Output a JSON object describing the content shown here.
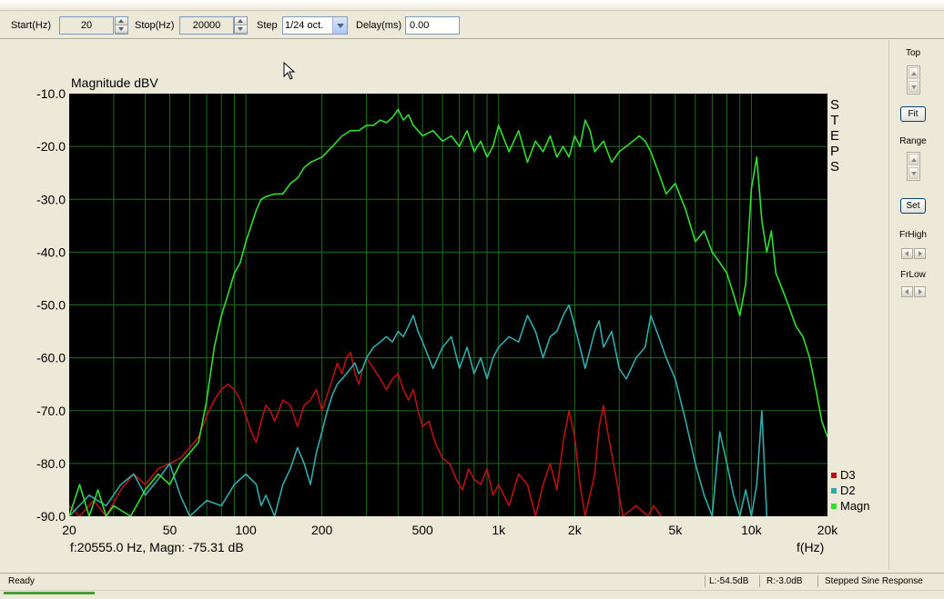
{
  "toolbar": {
    "start_label": "Start(Hz)",
    "start_value": "20",
    "stop_label": "Stop(Hz)",
    "stop_value": "20000",
    "step_label": "Step",
    "step_value": "1/24 oct.",
    "delay_label": "Delay(ms)",
    "delay_value": "0.00"
  },
  "side_panel": {
    "top_label": "Top",
    "fit_label": "Fit",
    "range_label": "Range",
    "set_label": "Set",
    "frhigh_label": "FrHigh",
    "frlow_label": "FrLow"
  },
  "plot": {
    "steps_text": "STEPS",
    "cursor_readout": "f:20555.0 Hz, Magn: -75.31 dB"
  },
  "status": {
    "left": "Ready",
    "level_l": "L:-54.5dB",
    "level_r": "R:-3.0dB",
    "mode": "Stepped Sine Response"
  },
  "colors": {
    "plot_background": "#000000",
    "grid": "#1f6b1f",
    "magn": "#33dd33",
    "d2": "#33aaaa",
    "d3": "#bb1111"
  },
  "chart_data": {
    "type": "line",
    "title": "",
    "ylabel": "Magnitude dBV",
    "xlabel": "f(Hz)",
    "xscale": "log",
    "xlim": [
      20,
      20000
    ],
    "ylim": [
      -90,
      -10
    ],
    "grid": true,
    "legend": "bottom-right",
    "x_ticks": [
      "20",
      "50",
      "100",
      "200",
      "500",
      "1k",
      "2k",
      "5k",
      "10k",
      "20k"
    ],
    "y_ticks": [
      "-10.0",
      "-20.0",
      "-30.0",
      "-40.0",
      "-50.0",
      "-60.0",
      "-70.0",
      "-80.0",
      "-90.0"
    ],
    "series": [
      {
        "name": "D3",
        "color": "#bb1111",
        "points": [
          [
            20,
            -88
          ],
          [
            22,
            -90
          ],
          [
            25,
            -87
          ],
          [
            28,
            -90
          ],
          [
            32,
            -85
          ],
          [
            36,
            -82
          ],
          [
            40,
            -84
          ],
          [
            45,
            -81
          ],
          [
            50,
            -80
          ],
          [
            55,
            -79
          ],
          [
            60,
            -77
          ],
          [
            65,
            -75
          ],
          [
            70,
            -71
          ],
          [
            75,
            -68
          ],
          [
            80,
            -66
          ],
          [
            85,
            -65
          ],
          [
            90,
            -66
          ],
          [
            95,
            -68
          ],
          [
            100,
            -71
          ],
          [
            105,
            -74
          ],
          [
            110,
            -76
          ],
          [
            115,
            -72
          ],
          [
            120,
            -69
          ],
          [
            125,
            -70
          ],
          [
            130,
            -72
          ],
          [
            135,
            -70
          ],
          [
            140,
            -68
          ],
          [
            150,
            -69
          ],
          [
            160,
            -73
          ],
          [
            170,
            -69
          ],
          [
            180,
            -68
          ],
          [
            190,
            -66
          ],
          [
            200,
            -70
          ],
          [
            210,
            -67
          ],
          [
            220,
            -64
          ],
          [
            230,
            -61
          ],
          [
            240,
            -63
          ],
          [
            250,
            -60
          ],
          [
            260,
            -59
          ],
          [
            270,
            -63
          ],
          [
            280,
            -65
          ],
          [
            290,
            -62
          ],
          [
            300,
            -60
          ],
          [
            320,
            -62
          ],
          [
            340,
            -64
          ],
          [
            360,
            -66
          ],
          [
            380,
            -64
          ],
          [
            400,
            -63
          ],
          [
            420,
            -66
          ],
          [
            440,
            -68
          ],
          [
            460,
            -66
          ],
          [
            480,
            -70
          ],
          [
            500,
            -73
          ],
          [
            530,
            -72
          ],
          [
            560,
            -76
          ],
          [
            600,
            -79
          ],
          [
            640,
            -80
          ],
          [
            680,
            -83
          ],
          [
            720,
            -85
          ],
          [
            760,
            -81
          ],
          [
            800,
            -83
          ],
          [
            850,
            -84
          ],
          [
            900,
            -81
          ],
          [
            950,
            -86
          ],
          [
            1000,
            -84
          ],
          [
            1100,
            -88
          ],
          [
            1200,
            -82
          ],
          [
            1300,
            -84
          ],
          [
            1400,
            -90
          ],
          [
            1500,
            -84
          ],
          [
            1600,
            -80
          ],
          [
            1700,
            -85
          ],
          [
            1800,
            -76
          ],
          [
            1900,
            -70
          ],
          [
            2000,
            -75
          ],
          [
            2100,
            -84
          ],
          [
            2200,
            -90
          ],
          [
            2400,
            -82
          ],
          [
            2500,
            -73
          ],
          [
            2600,
            -69
          ],
          [
            2700,
            -74
          ],
          [
            2900,
            -82
          ],
          [
            3100,
            -90
          ],
          [
            3500,
            -88
          ],
          [
            3900,
            -90
          ],
          [
            4100,
            -88
          ],
          [
            4400,
            -90
          ]
        ]
      },
      {
        "name": "D2",
        "color": "#33aaaa",
        "points": [
          [
            20,
            -90
          ],
          [
            24,
            -86
          ],
          [
            28,
            -88
          ],
          [
            32,
            -84
          ],
          [
            36,
            -82
          ],
          [
            40,
            -86
          ],
          [
            45,
            -83
          ],
          [
            50,
            -80
          ],
          [
            55,
            -86
          ],
          [
            60,
            -90
          ],
          [
            70,
            -87
          ],
          [
            80,
            -88
          ],
          [
            90,
            -84
          ],
          [
            100,
            -82
          ],
          [
            110,
            -84
          ],
          [
            115,
            -88
          ],
          [
            120,
            -86
          ],
          [
            130,
            -90
          ],
          [
            140,
            -84
          ],
          [
            150,
            -81
          ],
          [
            160,
            -77
          ],
          [
            170,
            -80
          ],
          [
            180,
            -84
          ],
          [
            190,
            -78
          ],
          [
            200,
            -74
          ],
          [
            210,
            -70
          ],
          [
            220,
            -67
          ],
          [
            230,
            -65
          ],
          [
            240,
            -64
          ],
          [
            250,
            -63
          ],
          [
            260,
            -62
          ],
          [
            270,
            -61
          ],
          [
            280,
            -63
          ],
          [
            290,
            -62
          ],
          [
            300,
            -60
          ],
          [
            320,
            -58
          ],
          [
            340,
            -57
          ],
          [
            360,
            -56
          ],
          [
            380,
            -57
          ],
          [
            400,
            -55
          ],
          [
            420,
            -56
          ],
          [
            440,
            -54
          ],
          [
            460,
            -52
          ],
          [
            480,
            -55
          ],
          [
            500,
            -57
          ],
          [
            550,
            -62
          ],
          [
            600,
            -58
          ],
          [
            650,
            -56
          ],
          [
            700,
            -62
          ],
          [
            750,
            -58
          ],
          [
            800,
            -63
          ],
          [
            850,
            -60
          ],
          [
            900,
            -64
          ],
          [
            950,
            -60
          ],
          [
            1000,
            -58
          ],
          [
            1100,
            -56
          ],
          [
            1200,
            -57
          ],
          [
            1300,
            -52
          ],
          [
            1400,
            -55
          ],
          [
            1500,
            -60
          ],
          [
            1600,
            -56
          ],
          [
            1700,
            -55
          ],
          [
            1800,
            -52
          ],
          [
            1900,
            -50
          ],
          [
            2000,
            -54
          ],
          [
            2100,
            -58
          ],
          [
            2200,
            -62
          ],
          [
            2400,
            -55
          ],
          [
            2500,
            -53
          ],
          [
            2600,
            -58
          ],
          [
            2800,
            -55
          ],
          [
            3000,
            -62
          ],
          [
            3200,
            -64
          ],
          [
            3500,
            -60
          ],
          [
            3800,
            -58
          ],
          [
            4000,
            -52
          ],
          [
            4300,
            -56
          ],
          [
            4600,
            -60
          ],
          [
            5000,
            -64
          ],
          [
            5500,
            -72
          ],
          [
            6000,
            -80
          ],
          [
            6500,
            -86
          ],
          [
            7000,
            -90
          ],
          [
            7500,
            -74
          ],
          [
            8000,
            -80
          ],
          [
            8500,
            -86
          ],
          [
            9000,
            -90
          ],
          [
            9500,
            -85
          ],
          [
            10000,
            -90
          ],
          [
            10500,
            -84
          ],
          [
            11000,
            -70
          ],
          [
            11500,
            -90
          ]
        ]
      },
      {
        "name": "Magn",
        "color": "#33dd33",
        "points": [
          [
            20,
            -90
          ],
          [
            22,
            -84
          ],
          [
            24,
            -90
          ],
          [
            26,
            -85
          ],
          [
            28,
            -90
          ],
          [
            30,
            -88
          ],
          [
            35,
            -90
          ],
          [
            40,
            -85
          ],
          [
            45,
            -82
          ],
          [
            50,
            -84
          ],
          [
            55,
            -80
          ],
          [
            60,
            -78
          ],
          [
            65,
            -76
          ],
          [
            70,
            -68
          ],
          [
            75,
            -58
          ],
          [
            80,
            -52
          ],
          [
            85,
            -48
          ],
          [
            90,
            -44
          ],
          [
            95,
            -42
          ],
          [
            100,
            -38
          ],
          [
            105,
            -35
          ],
          [
            110,
            -32
          ],
          [
            115,
            -30
          ],
          [
            120,
            -29.5
          ],
          [
            130,
            -29
          ],
          [
            140,
            -29
          ],
          [
            150,
            -27
          ],
          [
            160,
            -26
          ],
          [
            170,
            -24
          ],
          [
            180,
            -23
          ],
          [
            200,
            -22
          ],
          [
            220,
            -20
          ],
          [
            240,
            -18
          ],
          [
            260,
            -17
          ],
          [
            280,
            -17
          ],
          [
            300,
            -16
          ],
          [
            320,
            -16
          ],
          [
            340,
            -15
          ],
          [
            360,
            -15.5
          ],
          [
            380,
            -14.5
          ],
          [
            400,
            -13
          ],
          [
            420,
            -15
          ],
          [
            440,
            -14
          ],
          [
            460,
            -16
          ],
          [
            480,
            -17
          ],
          [
            500,
            -18
          ],
          [
            550,
            -17
          ],
          [
            600,
            -19
          ],
          [
            650,
            -18
          ],
          [
            700,
            -20
          ],
          [
            750,
            -17
          ],
          [
            800,
            -21
          ],
          [
            850,
            -19
          ],
          [
            900,
            -22
          ],
          [
            950,
            -20
          ],
          [
            1000,
            -16
          ],
          [
            1100,
            -21
          ],
          [
            1200,
            -17
          ],
          [
            1300,
            -23
          ],
          [
            1400,
            -19
          ],
          [
            1500,
            -21
          ],
          [
            1600,
            -18
          ],
          [
            1700,
            -22
          ],
          [
            1800,
            -20
          ],
          [
            1900,
            -22
          ],
          [
            2000,
            -18
          ],
          [
            2100,
            -20
          ],
          [
            2200,
            -15
          ],
          [
            2300,
            -17
          ],
          [
            2400,
            -21
          ],
          [
            2600,
            -19
          ],
          [
            2800,
            -23
          ],
          [
            3000,
            -21
          ],
          [
            3200,
            -20
          ],
          [
            3400,
            -19
          ],
          [
            3600,
            -18
          ],
          [
            3800,
            -19
          ],
          [
            4000,
            -21
          ],
          [
            4300,
            -25
          ],
          [
            4600,
            -29
          ],
          [
            5000,
            -27
          ],
          [
            5500,
            -32
          ],
          [
            6000,
            -38
          ],
          [
            6500,
            -36
          ],
          [
            7000,
            -40
          ],
          [
            7500,
            -42
          ],
          [
            8000,
            -44
          ],
          [
            8500,
            -48
          ],
          [
            9000,
            -52
          ],
          [
            9500,
            -46
          ],
          [
            10000,
            -28
          ],
          [
            10500,
            -22
          ],
          [
            11000,
            -34
          ],
          [
            11500,
            -40
          ],
          [
            12000,
            -36
          ],
          [
            12500,
            -44
          ],
          [
            13000,
            -46
          ],
          [
            14000,
            -50
          ],
          [
            15000,
            -54
          ],
          [
            16000,
            -56
          ],
          [
            17000,
            -60
          ],
          [
            18000,
            -66
          ],
          [
            19000,
            -72
          ],
          [
            20000,
            -75
          ]
        ]
      }
    ]
  }
}
